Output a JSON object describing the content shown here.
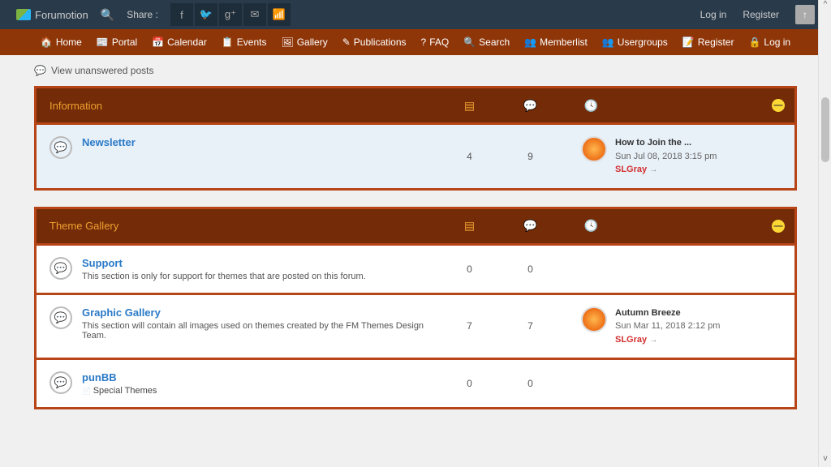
{
  "topbar": {
    "brand": "Forumotion",
    "share_label": "Share :",
    "login": "Log in",
    "register": "Register"
  },
  "nav": [
    {
      "icon": "🏠",
      "label": "Home"
    },
    {
      "icon": "📰",
      "label": "Portal"
    },
    {
      "icon": "📅",
      "label": "Calendar"
    },
    {
      "icon": "📋",
      "label": "Events"
    },
    {
      "icon": "🖼",
      "label": "Gallery"
    },
    {
      "icon": "✎",
      "label": "Publications"
    },
    {
      "icon": "?",
      "label": "FAQ"
    },
    {
      "icon": "🔍",
      "label": "Search"
    },
    {
      "icon": "👥",
      "label": "Memberlist"
    },
    {
      "icon": "👥",
      "label": "Usergroups"
    },
    {
      "icon": "📝",
      "label": "Register"
    },
    {
      "icon": "🔒",
      "label": "Log in"
    }
  ],
  "unanswered": "View unanswered posts",
  "categories": [
    {
      "title": "Information",
      "forums": [
        {
          "highlight": true,
          "title": "Newsletter",
          "desc": "",
          "topics": "4",
          "posts": "9",
          "last": {
            "title": "How to Join the ...",
            "date": "Sun Jul 08, 2018 3:15 pm",
            "user": "SLGray"
          }
        }
      ]
    },
    {
      "title": "Theme Gallery",
      "forums": [
        {
          "title": "Support",
          "desc": "This section is only for support for themes that are posted on this forum.",
          "topics": "0",
          "posts": "0",
          "last": null
        },
        {
          "title": "Graphic Gallery",
          "desc": "This section will contain all images used on themes created by the FM Themes Design Team.",
          "topics": "7",
          "posts": "7",
          "last": {
            "title": "Autumn Breeze",
            "date": "Sun Mar 11, 2018 2:12 pm",
            "user": "SLGray"
          }
        },
        {
          "title": "punBB",
          "desc": "",
          "subforum": "Special Themes",
          "topics": "0",
          "posts": "0",
          "last": null
        }
      ]
    }
  ]
}
